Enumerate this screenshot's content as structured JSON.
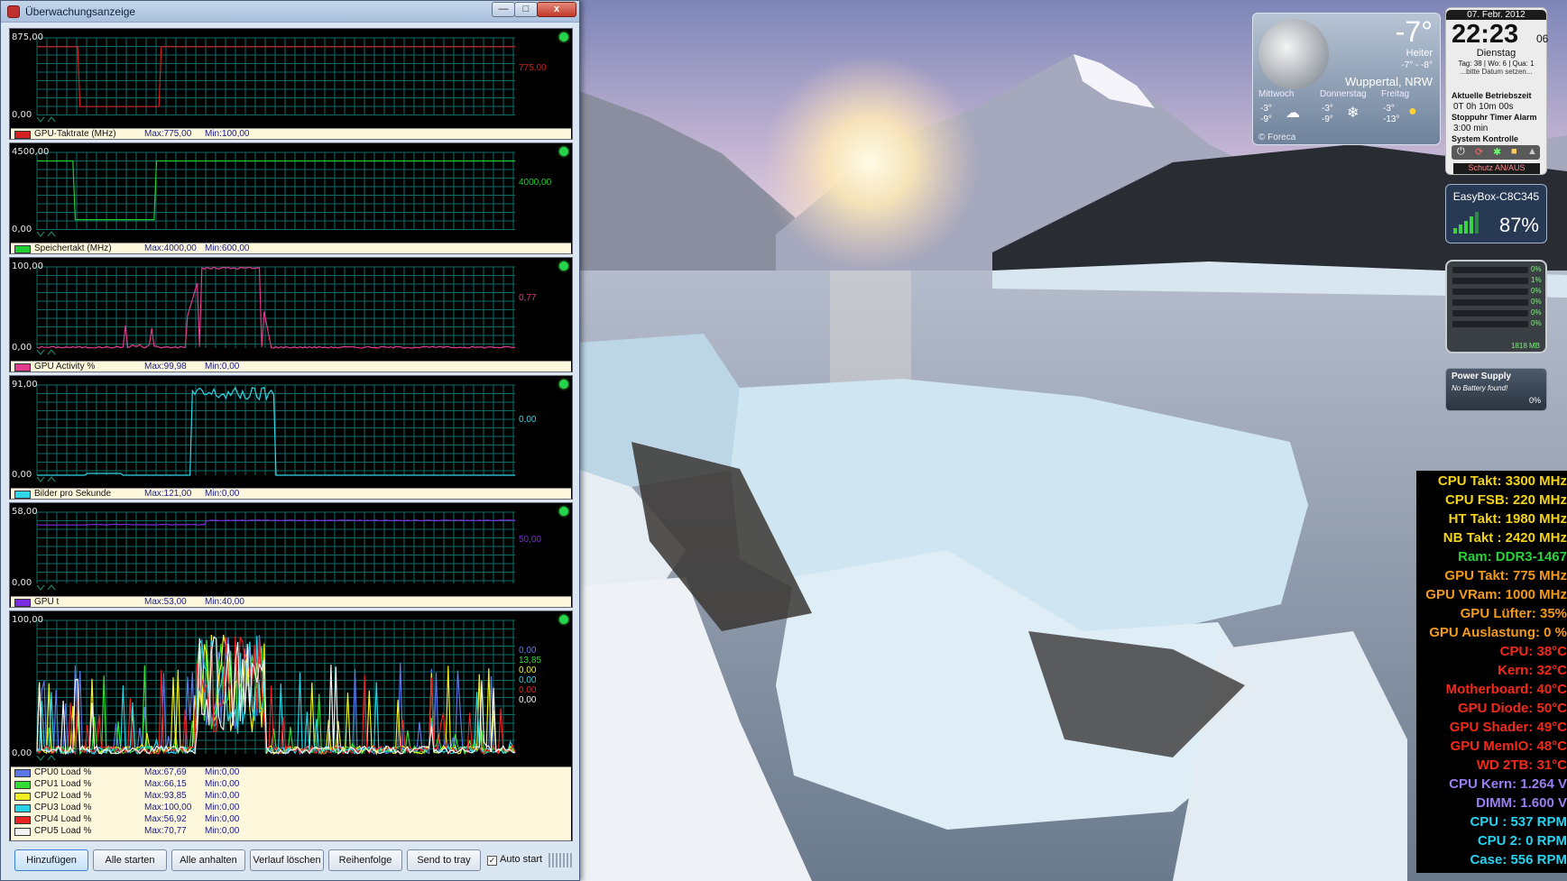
{
  "window": {
    "title": "Überwachungsanzeige",
    "controls": {
      "minimize": "—",
      "maximize": "□",
      "close": "x"
    }
  },
  "panels": [
    {
      "key": "gpu-clock",
      "axis_max": "875,00",
      "axis_min": "0,00",
      "current": "775,00",
      "series": [
        {
          "name": "GPU-Taktrate (MHz)",
          "max": "Max:775,00",
          "min": "Min:100,00",
          "color": "#d42020"
        }
      ]
    },
    {
      "key": "memory-clock",
      "axis_max": "4500,00",
      "axis_min": "0,00",
      "current": "4000,00",
      "series": [
        {
          "name": "Speichertakt (MHz)",
          "max": "Max:4000,00",
          "min": "Min:600,00",
          "color": "#22cc33"
        }
      ]
    },
    {
      "key": "gpu-activity",
      "axis_max": "100,00",
      "axis_min": "0,00",
      "current": "0,77",
      "series": [
        {
          "name": "GPU Activity %",
          "max": "Max:99,98",
          "min": "Min:0,00",
          "color": "#e23a8c"
        }
      ]
    },
    {
      "key": "fps",
      "axis_max": "91,00",
      "axis_min": "0,00",
      "current": "0,00",
      "series": [
        {
          "name": "Bilder pro Sekunde",
          "max": "Max:121,00",
          "min": "Min:0,00",
          "color": "#2fd7e6"
        }
      ]
    },
    {
      "key": "gpu-temp",
      "axis_max": "58,00",
      "axis_min": "0,00",
      "current": "50,00",
      "series": [
        {
          "name": "GPU t",
          "max": "Max:53,00",
          "min": "Min:40,00",
          "color": "#7a2be0"
        }
      ]
    },
    {
      "key": "cpu-load",
      "axis_max": "100,00",
      "axis_min": "0,00",
      "currents": [
        "0,00",
        "13,85",
        "0,00",
        "0,00",
        "0,00",
        "0,00"
      ],
      "series": [
        {
          "name": "CPU0 Load %",
          "max": "Max:67,69",
          "min": "Min:0,00",
          "color": "#5a78e8"
        },
        {
          "name": "CPU1 Load %",
          "max": "Max:66,15",
          "min": "Min:0,00",
          "color": "#33dd33"
        },
        {
          "name": "CPU2 Load %",
          "max": "Max:93,85",
          "min": "Min:0,00",
          "color": "#f0f020"
        },
        {
          "name": "CPU3 Load %",
          "max": "Max:100,00",
          "min": "Min:0,00",
          "color": "#28d2e4"
        },
        {
          "name": "CPU4 Load %",
          "max": "Max:56,92",
          "min": "Min:0,00",
          "color": "#e82424"
        },
        {
          "name": "CPU5 Load %",
          "max": "Max:70,77",
          "min": "Min:0,00",
          "color": "#f4f4f4"
        }
      ]
    }
  ],
  "toolbar": {
    "add": "Hinzufügen",
    "start_all": "Alle starten",
    "stop_all": "Alle anhalten",
    "clear_history": "Verlauf löschen",
    "order": "Reihenfolge",
    "send_to_tray": "Send to tray",
    "auto_start": "Auto start",
    "auto_start_checked": "✓"
  },
  "weather": {
    "temp": "-7°",
    "condition": "Heiter",
    "hilo": "-7° - -8°",
    "city": "Wuppertal, NRW",
    "forecast": [
      {
        "day": "Mittwoch",
        "hi": "-3°",
        "lo": "-9°",
        "icon": "cloud-icon"
      },
      {
        "day": "Donnerstag",
        "hi": "-3°",
        "lo": "-9°",
        "icon": "snow-icon"
      },
      {
        "day": "Freitag",
        "hi": "-3°",
        "lo": "-13°",
        "icon": "sun-icon"
      }
    ],
    "source": "© Foreca"
  },
  "clock": {
    "date": "07. Febr. 2012",
    "time": "22:23",
    "seconds": "06",
    "weekday": "Dienstag",
    "tag_line": "Tag: 38 | Wo: 6 | Qua: 1",
    "hint": "...bitte Datum setzen...",
    "uptime_label": "Aktuelle Betriebszeit",
    "uptime": "0T 0h 10m 00s",
    "stopwatch_label": "Stoppuhr Timer Alarm",
    "minutes": "3:00 min",
    "control_label": "System Kontrolle",
    "protect": "Schutz AN/AUS"
  },
  "wifi": {
    "ssid": "EasyBox-C8C345",
    "signal": "87%"
  },
  "meter": {
    "rows": [
      "0%",
      "1%",
      "0%",
      "0%",
      "0%",
      "0%"
    ],
    "memory": "1818 MB"
  },
  "power": {
    "title": "Power Supply",
    "status": "No Battery found!",
    "pct": "0%"
  },
  "sensors": [
    {
      "text": "CPU Takt: 3300 MHz",
      "color": "#f2d21a"
    },
    {
      "text": "CPU FSB: 220 MHz",
      "color": "#f2d21a"
    },
    {
      "text": "HT Takt: 1980 MHz",
      "color": "#f2d21a"
    },
    {
      "text": "NB Takt : 2420 MHz",
      "color": "#f2d21a"
    },
    {
      "text": "Ram: DDR3-1467",
      "color": "#2ad23a"
    },
    {
      "text": "GPU Takt: 775 MHz",
      "color": "#f29a1a"
    },
    {
      "text": "GPU VRam: 1000 MHz",
      "color": "#f29a1a"
    },
    {
      "text": "GPU Lüfter: 35%",
      "color": "#f29a1a"
    },
    {
      "text": "GPU Auslastung: 0 %",
      "color": "#f29a1a"
    },
    {
      "text": "CPU: 38°C",
      "color": "#f22a1a"
    },
    {
      "text": "Kern: 32°C",
      "color": "#f22a1a"
    },
    {
      "text": "Motherboard: 40°C",
      "color": "#f22a1a"
    },
    {
      "text": "GPU Diode: 50°C",
      "color": "#f22a1a"
    },
    {
      "text": "GPU Shader: 49°C",
      "color": "#f22a1a"
    },
    {
      "text": "GPU MemIO: 48°C",
      "color": "#f22a1a"
    },
    {
      "text": "WD 2TB: 31°C",
      "color": "#f22a1a"
    },
    {
      "text": "CPU Kern: 1.264 V",
      "color": "#9a7ef2"
    },
    {
      "text": "DIMM: 1.600 V",
      "color": "#9a7ef2"
    },
    {
      "text": "CPU : 537 RPM",
      "color": "#28d2f0"
    },
    {
      "text": "CPU 2: 0 RPM",
      "color": "#28d2f0"
    },
    {
      "text": "Case: 556 RPM",
      "color": "#28d2f0"
    }
  ]
}
